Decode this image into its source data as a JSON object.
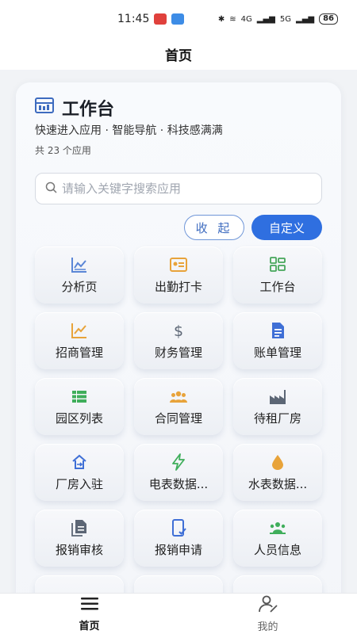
{
  "status_bar": {
    "time": "11:45",
    "battery": "86",
    "net1": "4G",
    "net2": "5G"
  },
  "nav": {
    "title": "首页"
  },
  "workbench": {
    "title": "工作台",
    "subtitle": "快速进入应用 · 智能导航 · 科技感满满",
    "count": "共 23 个应用",
    "search_placeholder": "请输入关键字搜索应用",
    "collapse_label": "收 起",
    "customize_label": "自定义"
  },
  "apps": [
    {
      "label": "分析页",
      "icon": "chart-icon",
      "color": "#5a86d6"
    },
    {
      "label": "出勤打卡",
      "icon": "id-card-icon",
      "color": "#e8a33a"
    },
    {
      "label": "工作台",
      "icon": "grid-icon",
      "color": "#46a65a"
    },
    {
      "label": "招商管理",
      "icon": "trend-icon",
      "color": "#e8a33a"
    },
    {
      "label": "财务管理",
      "icon": "dollar-icon",
      "color": "#5c6675"
    },
    {
      "label": "账单管理",
      "icon": "document-icon",
      "color": "#3f6fd6"
    },
    {
      "label": "园区列表",
      "icon": "list-icon",
      "color": "#3fae5b"
    },
    {
      "label": "合同管理",
      "icon": "people-icon",
      "color": "#e8a33a"
    },
    {
      "label": "待租厂房",
      "icon": "factory-icon",
      "color": "#5c6675"
    },
    {
      "label": "厂房入驻",
      "icon": "move-in-icon",
      "color": "#3f6fd6"
    },
    {
      "label": "电表数据...",
      "icon": "lightning-icon",
      "color": "#3fae5b"
    },
    {
      "label": "水表数据...",
      "icon": "water-drop-icon",
      "color": "#e8a33a"
    },
    {
      "label": "报销审核",
      "icon": "copy-doc-icon",
      "color": "#5c6675"
    },
    {
      "label": "报销申请",
      "icon": "phone-check-icon",
      "color": "#3f6fd6"
    },
    {
      "label": "人员信息",
      "icon": "group-icon",
      "color": "#3fae5b"
    },
    {
      "label": "",
      "icon": "partial-icon-1",
      "color": "#5c6675"
    },
    {
      "label": "",
      "icon": "partial-icon-2",
      "color": "#3f6fd6"
    },
    {
      "label": "",
      "icon": "partial-icon-3",
      "color": "#3fae5b"
    }
  ],
  "tabbar": [
    {
      "label": "首页",
      "icon": "menu-icon",
      "active": true
    },
    {
      "label": "我的",
      "icon": "user-icon",
      "active": false
    }
  ]
}
